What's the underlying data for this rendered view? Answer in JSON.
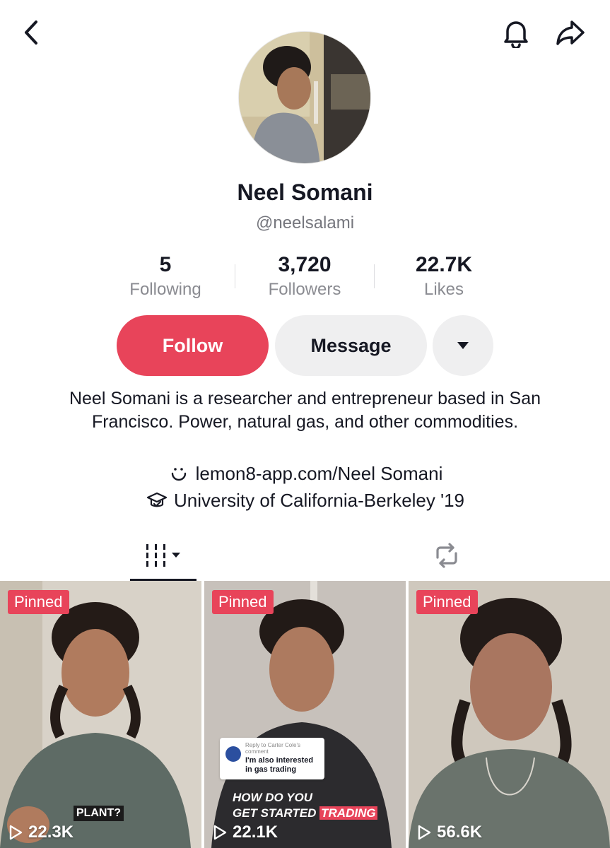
{
  "profile": {
    "display_name": "Neel Somani",
    "handle": "@neelsalami"
  },
  "stats": [
    {
      "value": "5",
      "label": "Following"
    },
    {
      "value": "3,720",
      "label": "Followers"
    },
    {
      "value": "22.7K",
      "label": "Likes"
    }
  ],
  "actions": {
    "follow_label": "Follow",
    "message_label": "Message"
  },
  "bio": {
    "text": "Neel Somani is a researcher and entrepreneur based in San Francisco. Power, natural gas, and other commodities.",
    "link": "lemon8-app.com/Neel Somani",
    "education": "University of California-Berkeley '19"
  },
  "tabs": {
    "active": "videos",
    "items": [
      "videos-grid-icon",
      "reposts-icon"
    ]
  },
  "videos": [
    {
      "pinned_label": "Pinned",
      "views": "22.3K",
      "caption": "PLANT?"
    },
    {
      "pinned_label": "Pinned",
      "views": "22.1K",
      "reply_header": "Reply to Carter Cole's comment",
      "reply_text": "I'm also interested in gas trading",
      "caption_line1": "HOW DO YOU",
      "caption_line2a": "GET STARTED",
      "caption_line2b": "TRADING"
    },
    {
      "pinned_label": "Pinned",
      "views": "56.6K"
    }
  ],
  "colors": {
    "accent": "#e8445a",
    "secondary_button": "#efeff0",
    "muted_text": "#8a8b91"
  }
}
